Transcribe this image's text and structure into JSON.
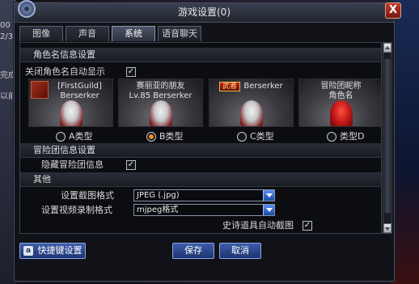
{
  "window": {
    "title": "游戏设置(0)"
  },
  "tabs": [
    {
      "label": "图像",
      "active": false
    },
    {
      "label": "声音",
      "active": false
    },
    {
      "label": "系统",
      "active": true
    },
    {
      "label": "语音聊天",
      "active": false
    }
  ],
  "sections": {
    "character_name": {
      "title": "角色名信息设置",
      "hide_option_label": "关闭角色名自动显示",
      "hide_option_checked": true,
      "cards": [
        {
          "line1": "[FirstGuild]",
          "line2": "Berserker",
          "option": "A类型",
          "selected": false
        },
        {
          "line1": "赛丽亚的朋友",
          "line2": "Lv.85 Berserker",
          "option": "B类型",
          "selected": true
        },
        {
          "line1": "Berserker",
          "line2": "",
          "option": "C类型",
          "selected": false,
          "badge": "武者"
        },
        {
          "line1": "冒险团昵称",
          "line2": "角色名",
          "option": "类型D",
          "selected": false
        }
      ]
    },
    "adventure_group": {
      "title": "冒险团信息设置",
      "hide_option_label": "隐藏冒险团信息",
      "hide_option_checked": true
    },
    "other": {
      "title": "其他",
      "screenshot_format_label": "设置截图格式",
      "screenshot_format_value": "JPEG (.jpg)",
      "video_format_label": "设置视频录制格式",
      "video_format_value": "mjpeg格式",
      "epic_auto_screenshot_label": "史诗道具自动截图",
      "epic_auto_screenshot_checked": true
    }
  },
  "buttons": {
    "shortcut_label": "快捷键设置",
    "save_label": "保存",
    "cancel_label": "取消"
  },
  "background": {
    "left_text": [
      "00",
      "2/3",
      "完成",
      "以前"
    ],
    "close_glyph": "X"
  },
  "colors": {
    "button_blue": "#1e3470",
    "radio_selected": "#ff8a20",
    "select_arrow": "#1a4aaa"
  }
}
